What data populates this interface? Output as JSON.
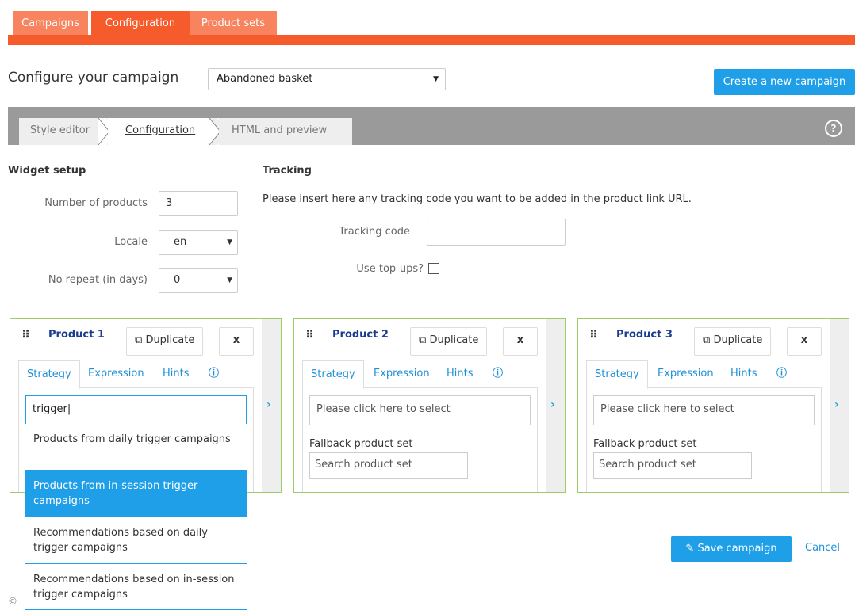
{
  "top_tabs": [
    "Campaigns",
    "Configuration",
    "Product sets"
  ],
  "configure": {
    "title": "Configure your campaign",
    "campaign_select": "Abandoned basket",
    "create_button": "Create a new campaign"
  },
  "steps": [
    "Style editor",
    "Configuration",
    "HTML and preview"
  ],
  "widget_setup": {
    "heading": "Widget setup",
    "num_products_label": "Number of products",
    "num_products_value": "3",
    "locale_label": "Locale",
    "locale_value": "en",
    "no_repeat_label": "No repeat (in days)",
    "no_repeat_value": "0"
  },
  "tracking": {
    "heading": "Tracking",
    "description": "Please insert here any tracking code you want to be added in the product link URL.",
    "code_label": "Tracking code",
    "code_value": "",
    "topups_label": "Use top-ups?"
  },
  "products": [
    {
      "title": "Product 1",
      "duplicate": "Duplicate",
      "close": "x",
      "tabs": [
        "Strategy",
        "Expression",
        "Hints"
      ],
      "strategy_value": "trigger",
      "fallback_label": "Fallback product set",
      "fallback_placeholder": "Search product set"
    },
    {
      "title": "Product 2",
      "duplicate": "Duplicate",
      "close": "x",
      "tabs": [
        "Strategy",
        "Expression",
        "Hints"
      ],
      "strategy_value": "Please click here to select",
      "fallback_label": "Fallback product set",
      "fallback_placeholder": "Search product set"
    },
    {
      "title": "Product 3",
      "duplicate": "Duplicate",
      "close": "x",
      "tabs": [
        "Strategy",
        "Expression",
        "Hints"
      ],
      "strategy_value": "Please click here to select",
      "fallback_label": "Fallback product set",
      "fallback_placeholder": "Search product set"
    }
  ],
  "dropdown": [
    "Products from daily trigger campaigns",
    "Products from in-session trigger campaigns",
    "Recommendations based on daily trigger campaigns",
    "Recommendations based on in-session trigger campaigns"
  ],
  "actions": {
    "save": "Save campaign",
    "cancel": "Cancel"
  },
  "footer": {
    "copyright": "©"
  },
  "colors": {
    "accent": "#f55b2b",
    "primary": "#1e9fe8",
    "panel_border": "#9ccc65"
  }
}
